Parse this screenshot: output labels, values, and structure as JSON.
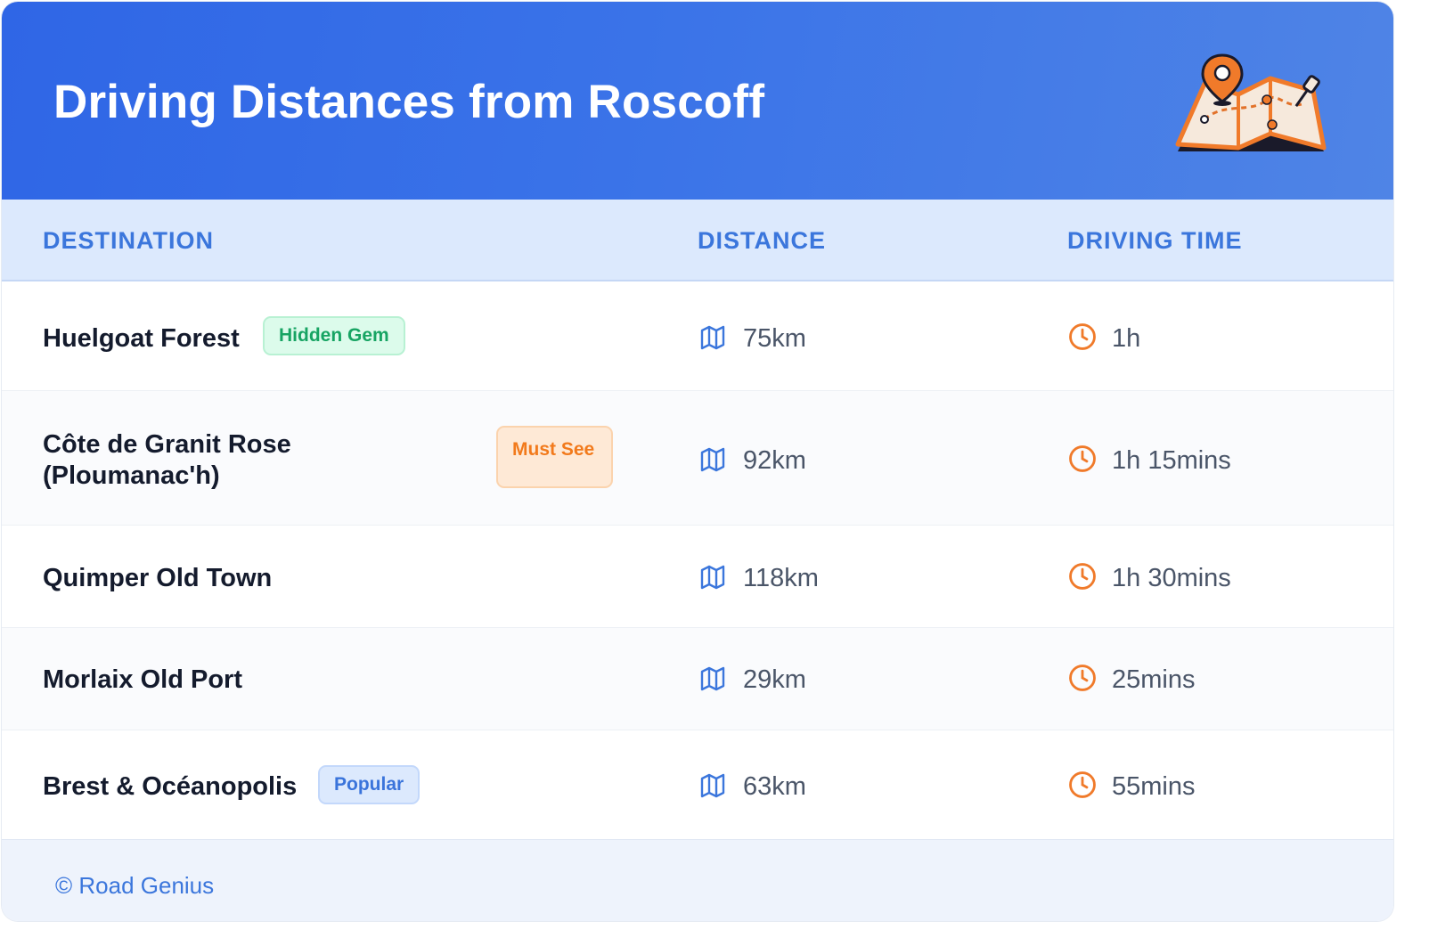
{
  "header": {
    "title": "Driving Distances from Roscoff"
  },
  "columns": {
    "destination": "DESTINATION",
    "distance": "DISTANCE",
    "driving_time": "DRIVING TIME"
  },
  "rows": [
    {
      "destination": "Huelgoat Forest",
      "badge": "Hidden Gem",
      "badge_color": "green",
      "distance": "75km",
      "time": "1h"
    },
    {
      "destination": "Côte de Granit Rose (Ploumanac'h)",
      "badge": "Must See",
      "badge_color": "orange",
      "distance": "92km",
      "time": "1h 15mins"
    },
    {
      "destination": "Quimper Old Town",
      "badge": "",
      "badge_color": "",
      "distance": "118km",
      "time": "1h 30mins"
    },
    {
      "destination": "Morlaix Old Port",
      "badge": "",
      "badge_color": "",
      "distance": "29km",
      "time": "25mins"
    },
    {
      "destination": "Brest & Océanopolis",
      "badge": "Popular",
      "badge_color": "blue",
      "distance": "63km",
      "time": "55mins"
    }
  ],
  "icons": {
    "distance": "map-icon",
    "time": "clock-icon",
    "header": "map-pin-illustration"
  },
  "colors": {
    "header_bg": "#2f66e6",
    "accent_blue": "#3b76dc",
    "accent_orange": "#f27a1c",
    "accent_green": "#17a463"
  },
  "footer": {
    "text": "© Road Genius"
  }
}
